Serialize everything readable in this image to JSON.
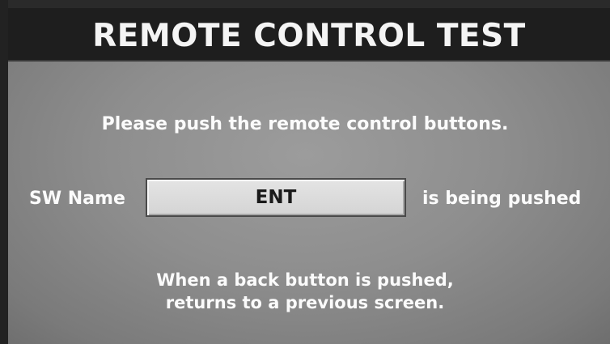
{
  "header": {
    "title": "REMOTE CONTROL TEST"
  },
  "main": {
    "instruction": "Please push the remote control buttons.",
    "switch_label": "SW Name",
    "switch_value": "ENT",
    "status_text": "is being pushed",
    "note_line1": "When a back button is pushed,",
    "note_line2": "returns to a previous screen."
  }
}
